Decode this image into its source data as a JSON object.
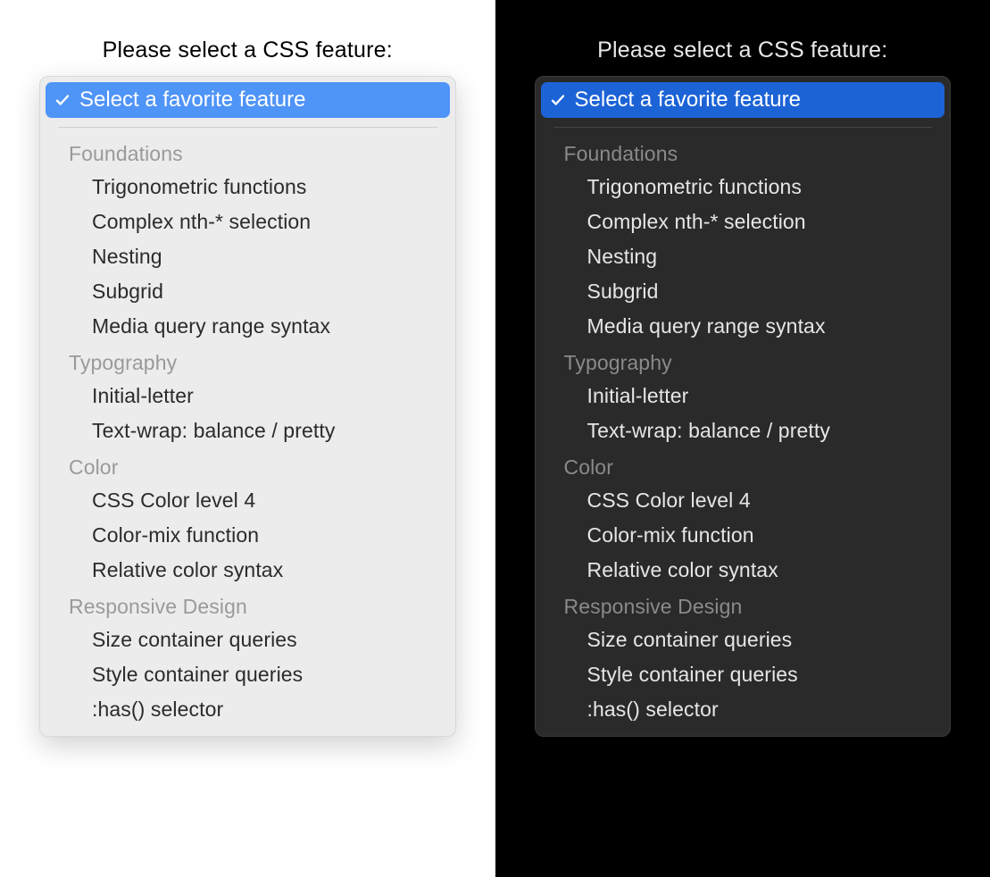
{
  "prompt": "Please select a CSS feature:",
  "selected_label": "Select a favorite feature",
  "colors": {
    "light_highlight": "#4f94f7",
    "dark_highlight": "#1c63d6"
  },
  "groups": [
    {
      "header": "Foundations",
      "options": [
        "Trigonometric functions",
        "Complex nth-* selection",
        "Nesting",
        "Subgrid",
        "Media query range syntax"
      ]
    },
    {
      "header": "Typography",
      "options": [
        "Initial-letter",
        "Text-wrap: balance / pretty"
      ]
    },
    {
      "header": "Color",
      "options": [
        "CSS Color level 4",
        "Color-mix function",
        "Relative color syntax"
      ]
    },
    {
      "header": "Responsive Design",
      "options": [
        "Size container queries",
        "Style container queries",
        ":has() selector"
      ]
    }
  ]
}
